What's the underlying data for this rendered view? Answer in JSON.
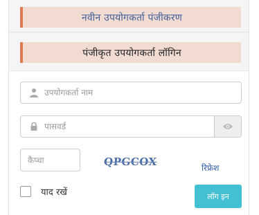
{
  "registration": {
    "label": "नवीन उपयोगकर्ता पंजीकरण"
  },
  "login": {
    "heading": "पंजीकृत उपयोगकर्ता लॉगिन",
    "username": {
      "placeholder": "उपयोगकर्ता नाम",
      "icon": "user-icon"
    },
    "password": {
      "placeholder": "पासवर्ड",
      "icon": "lock-icon",
      "toggle_icon": "eye-icon"
    },
    "captcha": {
      "placeholder": "कैप्चा",
      "image_text": "QPGCOX",
      "refresh_label": "रिफ्रेश"
    },
    "remember_label": "याद रखें",
    "submit_label": "लॉग इन"
  },
  "colors": {
    "banner_bg": "#f2dcd2",
    "banner_accent": "#e07a55",
    "link": "#3f5f9a",
    "button": "#43c1d3"
  }
}
